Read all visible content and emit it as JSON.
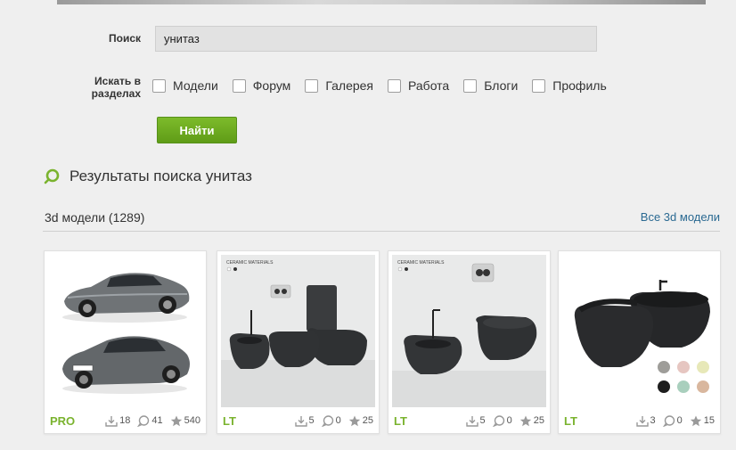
{
  "search": {
    "label": "Поиск",
    "value": "унитаз"
  },
  "sections": {
    "label_line1": "Искать в",
    "label_line2": "разделах",
    "items": [
      "Модели",
      "Форум",
      "Галерея",
      "Работа",
      "Блоги",
      "Профиль"
    ]
  },
  "find_button": "Найти",
  "results": {
    "title": "Результаты поиска унитаз"
  },
  "category": {
    "title": "3d модели (1289)",
    "link": "Все 3d модели"
  },
  "cards": [
    {
      "tier": "PRO",
      "downloads": "18",
      "comments": "41",
      "rating": "540"
    },
    {
      "tier": "LT",
      "badge": "CERAMIC MATERIALS",
      "downloads": "5",
      "comments": "0",
      "rating": "25"
    },
    {
      "tier": "LT",
      "badge": "CERAMIC MATERIALS",
      "downloads": "5",
      "comments": "0",
      "rating": "25"
    },
    {
      "tier": "LT",
      "downloads": "3",
      "comments": "0",
      "rating": "15"
    }
  ],
  "colors": {
    "accent_green": "#7ab32e",
    "link_blue": "#2b6a92",
    "button_green": "#6aa820"
  },
  "icons": [
    "search-icon",
    "download-icon",
    "comment-icon",
    "star-icon"
  ]
}
